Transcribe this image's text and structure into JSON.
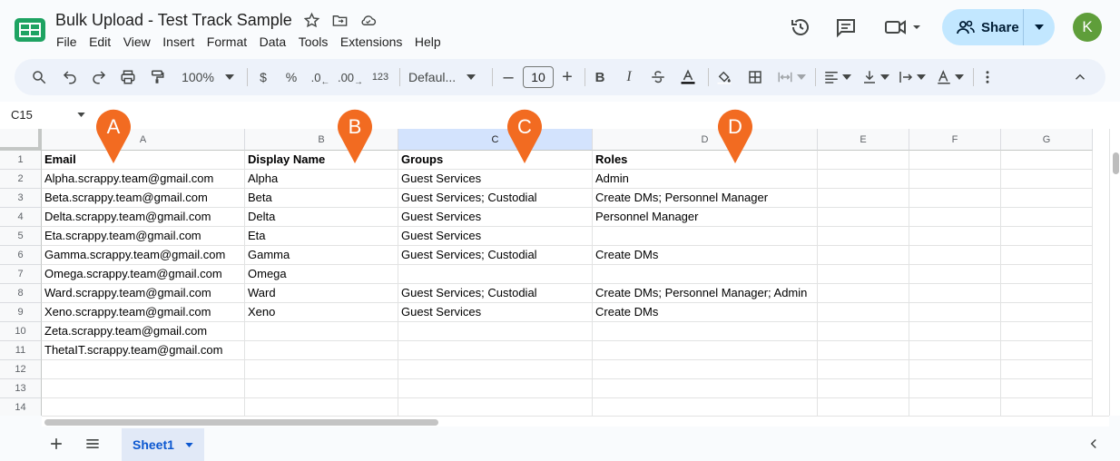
{
  "header": {
    "title": "Bulk Upload - Test Track Sample",
    "share_label": "Share",
    "avatar_initial": "K",
    "menu": [
      "File",
      "Edit",
      "View",
      "Insert",
      "Format",
      "Data",
      "Tools",
      "Extensions",
      "Help"
    ]
  },
  "toolbar": {
    "zoom": "100%",
    "currency": "$",
    "percent": "%",
    "decrease_decimal": ".0",
    "increase_decimal": ".00",
    "number_format": "123",
    "font": "Defaul...",
    "font_size": "10",
    "bold": "B",
    "italic": "I"
  },
  "formula_bar": {
    "name_box": "C15"
  },
  "columns": [
    {
      "letter": "A",
      "selected": false
    },
    {
      "letter": "B",
      "selected": false
    },
    {
      "letter": "C",
      "selected": true
    },
    {
      "letter": "D",
      "selected": false
    },
    {
      "letter": "E",
      "selected": false
    },
    {
      "letter": "F",
      "selected": false
    },
    {
      "letter": "G",
      "selected": false
    }
  ],
  "rows": [
    "1",
    "2",
    "3",
    "4",
    "5",
    "6",
    "7",
    "8",
    "9",
    "10",
    "11",
    "12",
    "13",
    "14"
  ],
  "cells": [
    [
      "Email",
      "Display Name",
      "Groups",
      "Roles"
    ],
    [
      "Alpha.scrappy.team@gmail.com",
      "Alpha",
      "Guest Services",
      "Admin"
    ],
    [
      "Beta.scrappy.team@gmail.com",
      "Beta",
      "Guest Services; Custodial",
      "Create DMs; Personnel Manager"
    ],
    [
      "Delta.scrappy.team@gmail.com",
      "Delta",
      "Guest Services",
      "Personnel Manager"
    ],
    [
      "Eta.scrappy.team@gmail.com",
      "Eta",
      "Guest Services",
      ""
    ],
    [
      "Gamma.scrappy.team@gmail.com",
      "Gamma",
      "Guest Services; Custodial",
      "Create DMs"
    ],
    [
      "Omega.scrappy.team@gmail.com",
      "Omega",
      "",
      ""
    ],
    [
      "Ward.scrappy.team@gmail.com",
      "Ward",
      "Guest Services; Custodial",
      "Create DMs; Personnel Manager; Admin"
    ],
    [
      "Xeno.scrappy.team@gmail.com",
      "Xeno",
      "Guest Services",
      "Create DMs"
    ],
    [
      "Zeta.scrappy.team@gmail.com",
      "",
      "",
      ""
    ],
    [
      "ThetaIT.scrappy.team@gmail.com",
      "",
      "",
      ""
    ]
  ],
  "markers": [
    "A",
    "B",
    "C",
    "D"
  ],
  "marker_color": "#f26b21",
  "sheets": [
    "Sheet1"
  ]
}
